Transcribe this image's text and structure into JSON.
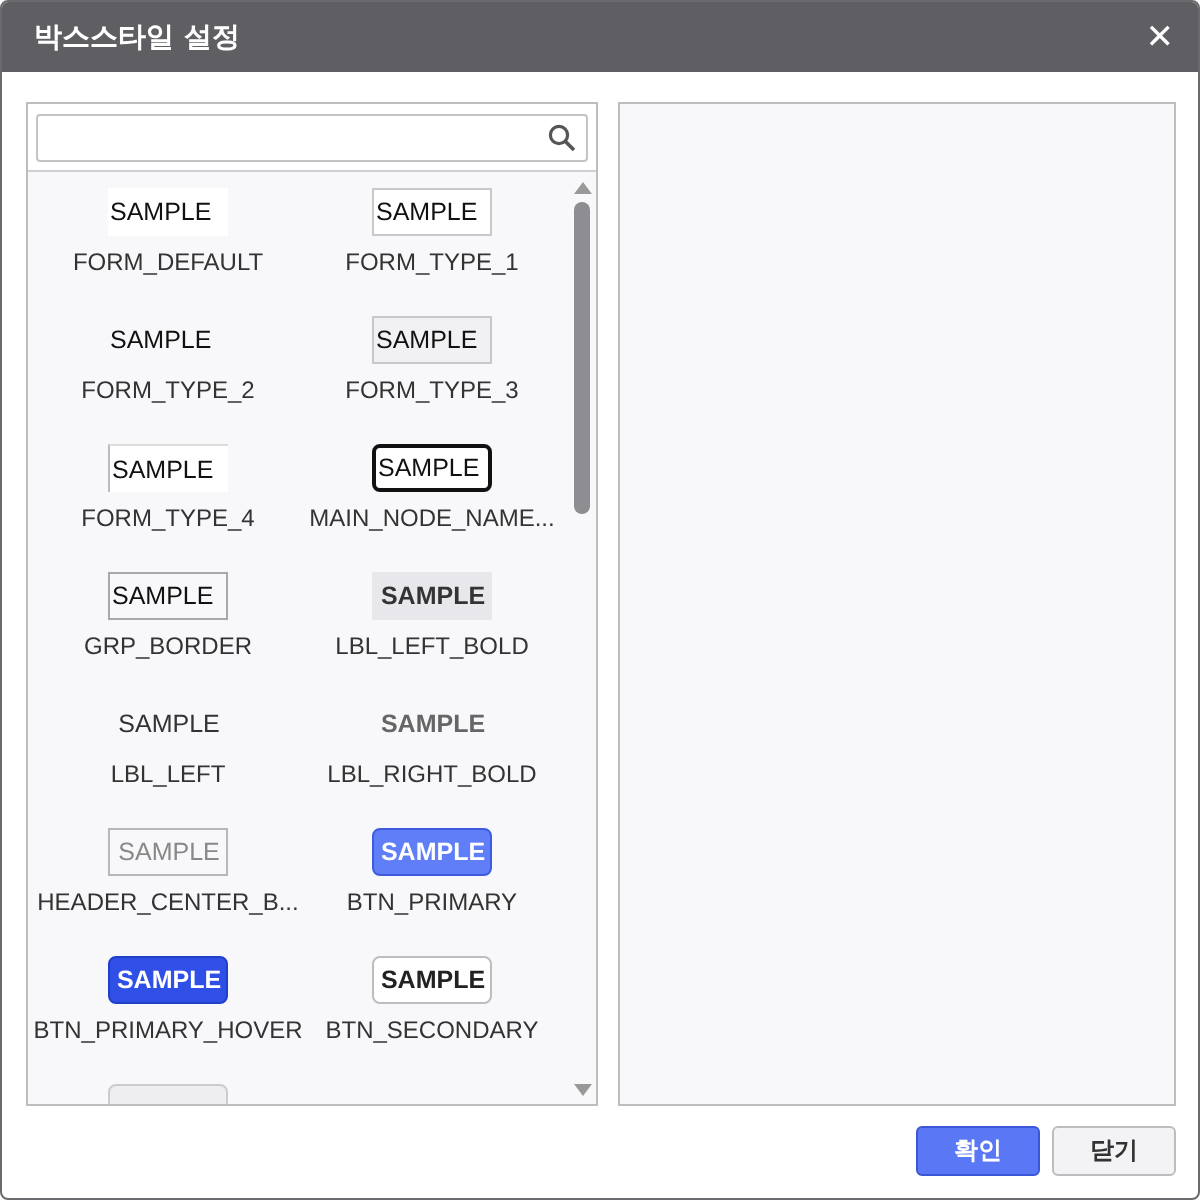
{
  "window": {
    "title": "박스스타일 설정",
    "close": "✕"
  },
  "styles": [
    {
      "kind": "white",
      "sample": "SAMPLE",
      "label": "FORM_DEFAULT"
    },
    {
      "kind": "bordered",
      "sample": "SAMPLE",
      "label": "FORM_TYPE_1"
    },
    {
      "kind": "plain",
      "sample": "SAMPLE",
      "label": "FORM_TYPE_2"
    },
    {
      "kind": "grey-fill",
      "sample": "SAMPLE",
      "label": "FORM_TYPE_3"
    },
    {
      "kind": "inset",
      "sample": "SAMPLE",
      "label": "FORM_TYPE_4"
    },
    {
      "kind": "dark-rounded",
      "sample": "SAMPLE",
      "label": "MAIN_NODE_NAME..."
    },
    {
      "kind": "group-border",
      "sample": "SAMPLE",
      "label": "GRP_BORDER"
    },
    {
      "kind": "grey-bold",
      "sample": "SAMPLE",
      "label": "LBL_LEFT_BOLD"
    },
    {
      "kind": "plain-left",
      "sample": "SAMPLE",
      "label": "LBL_LEFT"
    },
    {
      "kind": "bold-text",
      "sample": "SAMPLE",
      "label": "LBL_RIGHT_BOLD"
    },
    {
      "kind": "faint",
      "sample": "SAMPLE",
      "label": "HEADER_CENTER_B..."
    },
    {
      "kind": "primary",
      "sample": "SAMPLE",
      "label": "BTN_PRIMARY"
    },
    {
      "kind": "primary-hover",
      "sample": "SAMPLE",
      "label": "BTN_PRIMARY_HOVER"
    },
    {
      "kind": "secondary",
      "sample": "SAMPLE",
      "label": "BTN_SECONDARY"
    },
    {
      "kind": "clipped"
    }
  ],
  "buttons": [
    {
      "kind": "primary",
      "label": "확인"
    },
    {
      "kind": "secondary",
      "label": "닫기"
    }
  ]
}
